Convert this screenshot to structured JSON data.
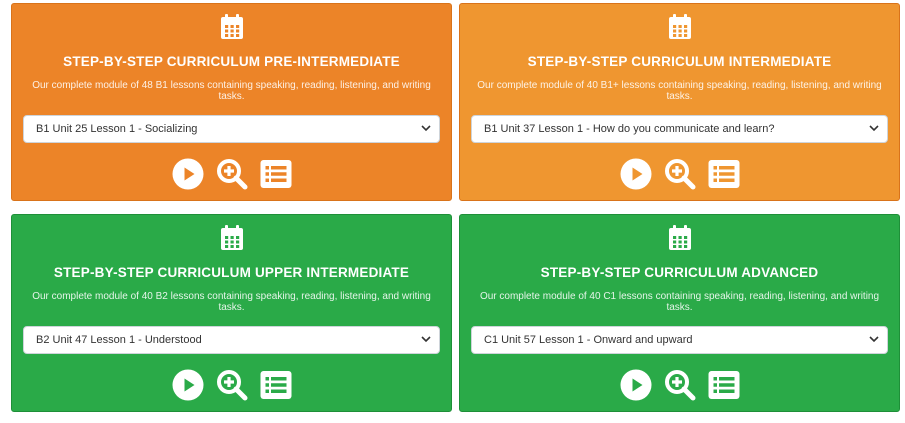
{
  "cards": [
    {
      "title": "STEP-BY-STEP CURRICULUM PRE-INTERMEDIATE",
      "description": "Our complete module of 48 B1 lessons containing speaking, reading, listening, and writing tasks.",
      "selected_lesson": "B1 Unit 25 Lesson 1 - Socializing",
      "background": "#ec8428"
    },
    {
      "title": "STEP-BY-STEP CURRICULUM INTERMEDIATE",
      "description": "Our complete module of 40 B1+ lessons containing speaking, reading, listening, and writing tasks.",
      "selected_lesson": "B1 Unit 37 Lesson 1 - How do you communicate and learn?",
      "background": "#ef9630"
    },
    {
      "title": "STEP-BY-STEP CURRICULUM UPPER INTERMEDIATE",
      "description": "Our complete module of 40 B2 lessons containing speaking, reading, listening, and writing tasks.",
      "selected_lesson": "B2 Unit 47 Lesson 1 - Understood",
      "background": "#2aaa48"
    },
    {
      "title": "STEP-BY-STEP CURRICULUM ADVANCED",
      "description": "Our complete module of 40 C1 lessons containing speaking, reading, listening, and writing tasks.",
      "selected_lesson": "C1 Unit 57 Lesson 1 - Onward and upward",
      "background": "#2aaa48"
    }
  ],
  "icons": {
    "header": "calendar-icon",
    "play": "play-icon",
    "preview": "zoom-in-icon",
    "list": "list-icon",
    "dropdown": "chevron-down-icon"
  },
  "colors": {
    "border_orange": "#d9731a",
    "border_green": "#1e8f38"
  }
}
